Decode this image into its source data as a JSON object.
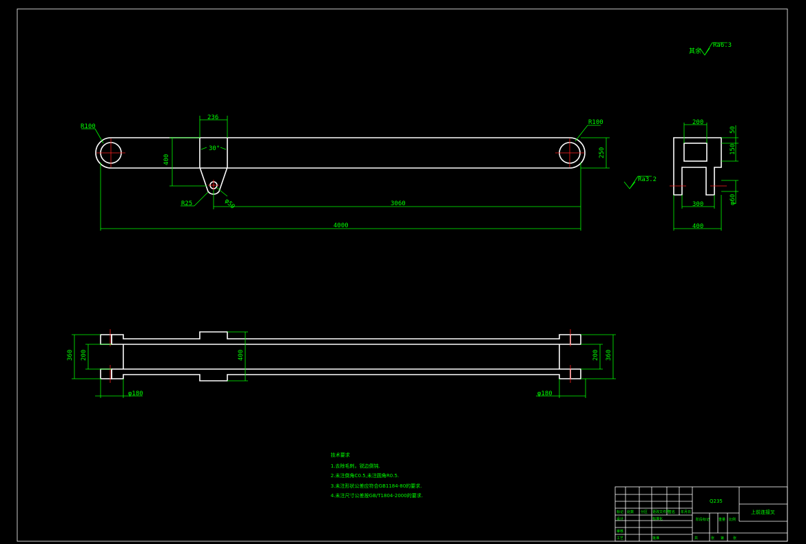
{
  "dimensions": {
    "top_r_left": "R100",
    "top_r_right": "R100",
    "top_236": "236",
    "top_angle": "30°",
    "top_400": "400",
    "top_250": "250",
    "top_r25": "R25",
    "top_phi50": "φ50",
    "top_3060": "3060",
    "top_4000": "4000",
    "side_200": "200",
    "side_50": "50",
    "side_150": "150",
    "side_phi60": "φ60",
    "side_300": "300",
    "side_400": "400",
    "rough_main": "Ra6.3",
    "rough_main_label": "其余",
    "rough_side": "Ra3.2",
    "bot_360_left": "360",
    "bot_200_left": "200",
    "bot_400": "400",
    "bot_200_right": "200",
    "bot_360_right": "360",
    "bot_phi180_left": "φ180",
    "bot_phi180_right": "φ180"
  },
  "notes": {
    "title": "技术要求",
    "lines": [
      "1.去除毛刺，锐边倒钝.",
      "2.未注倒角C0.5,未注圆角R0.5.",
      "3.未注形状公差应符合GB1184-80的要求.",
      "4.未注尺寸公差按GB/T1804-2000的要求."
    ]
  },
  "titleblock": {
    "material": "Q235",
    "part_name": "上前连接叉",
    "cell_labels": [
      "标记",
      "处数",
      "分区",
      "更改文件号",
      "签名",
      "年月日",
      "设计",
      "标准化",
      "审核",
      "工艺",
      "批准",
      "阶段标记",
      "重量",
      "比例",
      "共",
      "张",
      "第",
      "张"
    ]
  },
  "colors": {
    "outline": "#ffffff",
    "dimension": "#00ff00",
    "centerline": "#ff2020",
    "background": "#000000"
  }
}
